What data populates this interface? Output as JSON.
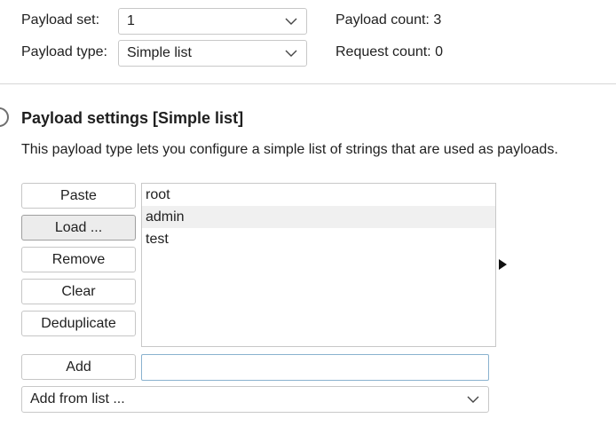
{
  "payload_set": {
    "label": "Payload set:",
    "value": "1"
  },
  "payload_type": {
    "label": "Payload type:",
    "value": "Simple list"
  },
  "payload_count": {
    "label": "Payload count:",
    "value": "3"
  },
  "request_count": {
    "label": "Request count:",
    "value": "0"
  },
  "settings": {
    "title": "Payload settings [Simple list]",
    "description": "This payload type lets you configure a simple list of strings that are used as payloads."
  },
  "buttons": {
    "paste": "Paste",
    "load": "Load ...",
    "remove": "Remove",
    "clear": "Clear",
    "deduplicate": "Deduplicate",
    "add": "Add"
  },
  "payload_list": [
    "root",
    "admin",
    "test"
  ],
  "add_input": {
    "value": ""
  },
  "add_from_list": {
    "value": "Add from list ..."
  }
}
